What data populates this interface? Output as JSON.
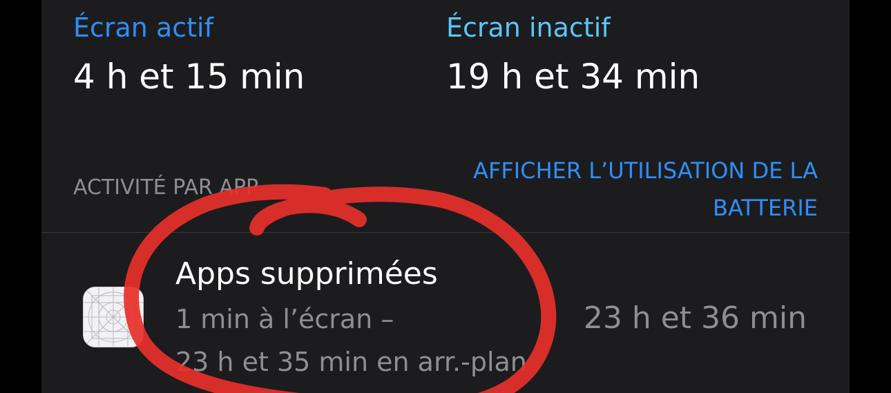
{
  "summary": {
    "active": {
      "label": "Écran actif",
      "value": "4 h et 15 min"
    },
    "inactive": {
      "label": "Écran inactif",
      "value": "19 h et 34 min"
    }
  },
  "activity": {
    "header": "ACTIVITÉ PAR APP",
    "battery_link": "AFFICHER L’UTILISATION DE LA BATTERIE"
  },
  "apps": [
    {
      "name": "Apps supprimées",
      "detail_line1": "1 min à l’écran –",
      "detail_line2": "23 h et 35 min en arr.-plan",
      "total": "23 h et 36 min",
      "icon": "app-placeholder-icon"
    }
  ],
  "colors": {
    "accent_blue": "#2f8ff7",
    "light_blue": "#5ac8fa",
    "background": "#1c1c1e",
    "annotation_red": "#e8302a"
  }
}
